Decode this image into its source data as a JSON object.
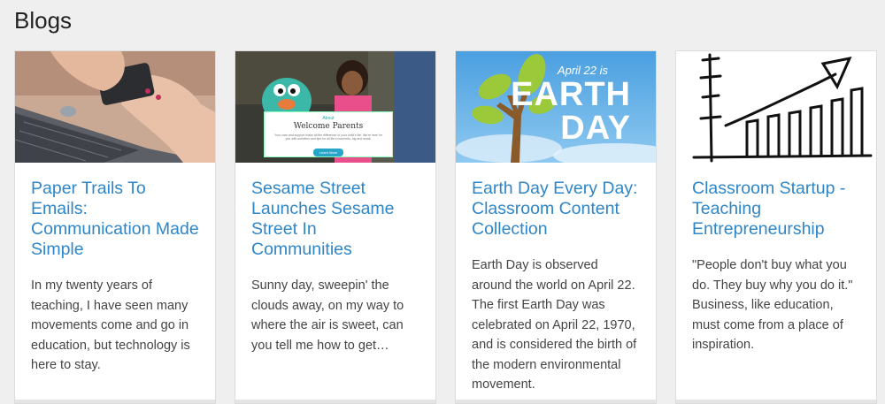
{
  "page": {
    "title": "Blogs"
  },
  "cards": [
    {
      "image_alt": "hands holding phone over laptop",
      "title": "Paper Trails To Emails: Communication Made Simple",
      "excerpt": "In my twenty years of teaching, I have seen many movements come and go in education, but technology is here to stay."
    },
    {
      "image_alt": "muppet and girl",
      "title": "Sesame Street Launches Sesame Street In Communities",
      "excerpt": "Sunny day, sweepin' the clouds away, on my way to where the air is sweet, can you tell me how to get…",
      "overlay": {
        "about": "About",
        "heading": "Welcome Parents",
        "description": "Your care and support make all the difference in your child's life. We're here for you with activities and tips for all life's moments, big and small.",
        "button": "Learn More"
      }
    },
    {
      "image_alt": "earth day tree",
      "title": "Earth Day Every Day: Classroom Content Collection",
      "excerpt": "Earth Day is observed around the world on April 22. The first Earth Day was celebrated on April 22, 1970, and is considered the birth of the modern environmental movement.",
      "overlay": {
        "date": "April 22 is",
        "word1": "EARTH",
        "word2": "DAY"
      }
    },
    {
      "image_alt": "hand-drawn bar chart sketch",
      "title": "Classroom Startup - Teaching Entrepreneurship",
      "excerpt": "\"People don't buy what you do. They buy why you do it.\" Business, like education, must come from a place of inspiration."
    }
  ],
  "colors": {
    "link": "#2e86c9",
    "background": "#efefef",
    "sky": "#5aa9e0",
    "leaf": "#9cc93a",
    "trunk": "#8a5a2b"
  }
}
